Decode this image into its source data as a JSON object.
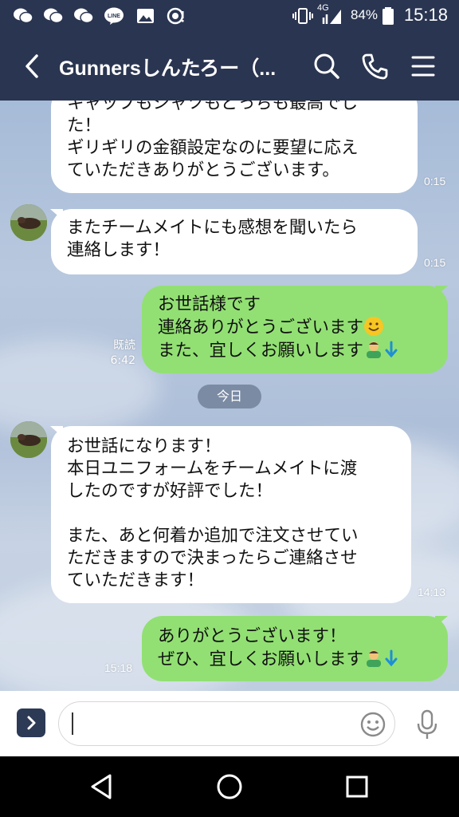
{
  "status_bar": {
    "network": "4G",
    "battery_percent": "84%",
    "time": "15:18",
    "notification_icons": [
      "wechat-icon",
      "wechat-icon",
      "wechat-icon",
      "line-icon",
      "image-icon",
      "alert-icon"
    ]
  },
  "header": {
    "title": "Gunnersしんたろー（...",
    "actions": [
      "search-icon",
      "phone-icon",
      "menu-icon"
    ]
  },
  "messages": [
    {
      "side": "in",
      "lines": [
        "キャップもシャツもどっちも最高でし",
        "た！",
        "ギリギリの金額設定なのに要望に応え",
        "ていただきありがとうございます。"
      ],
      "time": "0:15"
    },
    {
      "side": "in",
      "lines": [
        "またチームメイトにも感想を聞いたら",
        "連絡します！"
      ],
      "time": "0:15"
    },
    {
      "side": "out",
      "lines": [
        "お世話様です",
        "連絡ありがとうございます",
        "また、宜しくお願いします"
      ],
      "read": "既読",
      "time": "6:42"
    },
    {
      "side": "in",
      "lines": [
        "お世話になります！",
        "本日ユニフォームをチームメイトに渡",
        "したのですが好評でした！",
        "",
        "また、あと何着か追加で注文させてい",
        "ただきますので決まったらご連絡させ",
        "ていただきます！"
      ],
      "time": "14:13"
    },
    {
      "side": "out",
      "lines": [
        "ありがとうございます！",
        "ぜひ、宜しくお願いします"
      ],
      "time": "15:18"
    }
  ],
  "date_separator": "今日",
  "input": {
    "placeholder": "",
    "value": ""
  },
  "colors": {
    "header_bg": "#2a3551",
    "outgoing_bubble": "#92e073",
    "incoming_bubble": "#ffffff"
  }
}
